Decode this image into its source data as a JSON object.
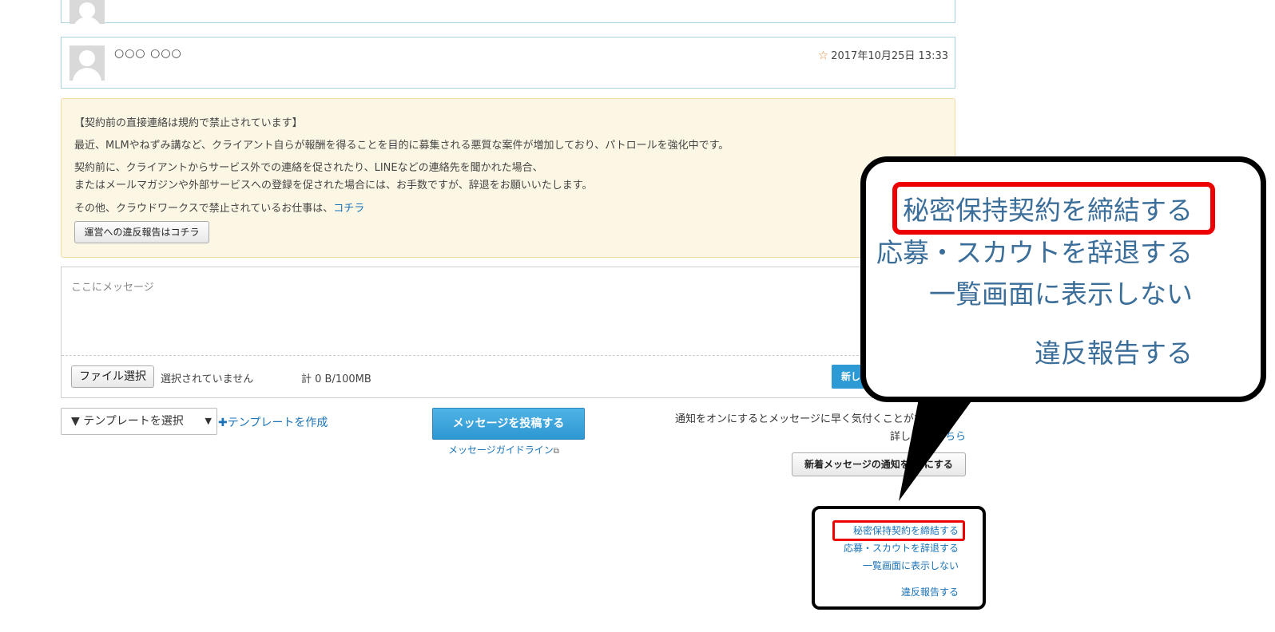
{
  "prev_card": {},
  "message_card": {
    "sender_name": "○○○ ○○○",
    "star_icon": "star-outline-icon",
    "date": "2017年10月25日 13:33"
  },
  "warning": {
    "title": "【契約前の直接連絡は規約で禁止されています】",
    "line1": "最近、MLMやねずみ講など、クライアント自らが報酬を得ることを目的に募集される悪質な案件が増加しており、パトロールを強化中です。",
    "line2": "契約前に、クライアントからサービス外での連絡を促されたり、LINEなどの連絡先を聞かれた場合、",
    "line3": "またはメールマガジンや外部サービスへの登録を促された場合には、お手数ですが、辞退をお願いいたします。",
    "line4_prefix": "その他、クラウドワークスで禁止されているお仕事は、",
    "line4_link": "コチラ",
    "report_button": "運営への違反報告はコチラ"
  },
  "compose": {
    "placeholder": "ここにメッセージ",
    "file_button": "ファイル選択",
    "file_status": "選択されていません",
    "file_size": "計 0 B/100MB",
    "new_button": "新し"
  },
  "template": {
    "select_label": "▼ テンプレートを選択",
    "caret": "▼",
    "create_link": "テンプレートを作成",
    "plus_icon": "plus-icon"
  },
  "post": {
    "button": "メッセージを投稿する",
    "guideline": "メッセージガイドライン",
    "external_icon": "external-link-icon"
  },
  "notify": {
    "text": "通知をオンにするとメッセージに早く気付くことがで",
    "detail": "詳しく",
    "detail_tail": "ちら",
    "button": "新着メッセージの通知を",
    "button_tail": "にする"
  },
  "actions": {
    "nda": "秘密保持契約を締結する",
    "decline": "応募・スカウトを辞退する",
    "hide": "一覧画面に表示しない",
    "report": "違反報告する"
  },
  "colors": {
    "link": "#1a73b8",
    "highlight": "#ee0000",
    "primary_button": "#2e97d1",
    "warning_bg": "#fcf7e4",
    "star": "#e8873a"
  }
}
